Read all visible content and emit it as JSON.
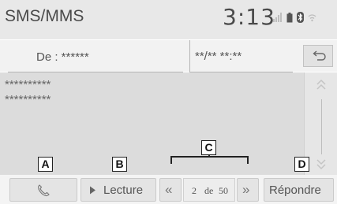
{
  "header": {
    "title": "SMS/MMS",
    "time": "3:13",
    "status_icons": [
      "signal-icon",
      "battery-icon",
      "bluetooth-icon",
      "wifi-icon"
    ]
  },
  "message": {
    "sender_label": "De : ******",
    "datetime": "**/** **:**",
    "body_lines": [
      "**********",
      "**********"
    ]
  },
  "controls": {
    "call_icon": "phone-icon",
    "play_label": "Lecture",
    "prev_icon": "double-chevron-left-icon",
    "page_current": "2",
    "page_separator": "de",
    "page_total": "50",
    "next_icon": "double-chevron-right-icon",
    "reply_label": "Répondre"
  },
  "callouts": {
    "a": "A",
    "b": "B",
    "c": "C",
    "d": "D"
  },
  "colors": {
    "header_bg": "#e8e8e8",
    "body_bg": "#dcdcdc",
    "button_bg": "#e4e4e4",
    "text": "#555555"
  }
}
